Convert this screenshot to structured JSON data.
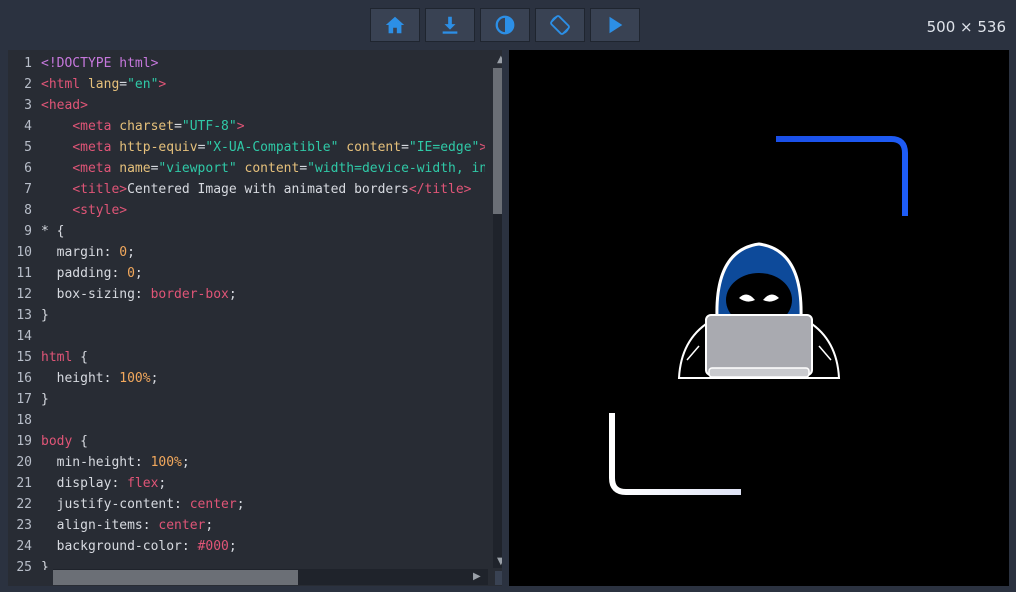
{
  "toolbar": {
    "buttons": [
      {
        "icon": "home-icon"
      },
      {
        "icon": "download-icon"
      },
      {
        "icon": "contrast-icon"
      },
      {
        "icon": "rotate-icon"
      },
      {
        "icon": "play-icon"
      }
    ],
    "accent": "#2c8fe6"
  },
  "preview_size": "500 × 536",
  "editor": {
    "line_numbers": [
      "1",
      "2",
      "3",
      "4",
      "5",
      "6",
      "7",
      "8",
      "9",
      "10",
      "11",
      "12",
      "13",
      "14",
      "15",
      "16",
      "17",
      "18",
      "19",
      "20",
      "21",
      "22",
      "23",
      "24",
      "25"
    ],
    "lines": [
      [
        [
          "doctype",
          "<!DOCTYPE html>"
        ]
      ],
      [
        [
          "tag",
          "<html "
        ],
        [
          "attr",
          "lang"
        ],
        [
          "txt",
          "="
        ],
        [
          "str",
          "\"en\""
        ],
        [
          "tag",
          ">"
        ]
      ],
      [
        [
          "tag",
          "<head>"
        ]
      ],
      [
        [
          "txt",
          "    "
        ],
        [
          "tag",
          "<meta "
        ],
        [
          "attr",
          "charset"
        ],
        [
          "txt",
          "="
        ],
        [
          "str",
          "\"UTF-8\""
        ],
        [
          "tag",
          ">"
        ]
      ],
      [
        [
          "txt",
          "    "
        ],
        [
          "tag",
          "<meta "
        ],
        [
          "attr",
          "http-equiv"
        ],
        [
          "txt",
          "="
        ],
        [
          "str",
          "\"X-UA-Compatible\""
        ],
        [
          "txt",
          " "
        ],
        [
          "attr",
          "content"
        ],
        [
          "txt",
          "="
        ],
        [
          "str",
          "\"IE=edge\""
        ],
        [
          "tag",
          ">"
        ]
      ],
      [
        [
          "txt",
          "    "
        ],
        [
          "tag",
          "<meta "
        ],
        [
          "attr",
          "name"
        ],
        [
          "txt",
          "="
        ],
        [
          "str",
          "\"viewport\""
        ],
        [
          "txt",
          " "
        ],
        [
          "attr",
          "content"
        ],
        [
          "txt",
          "="
        ],
        [
          "str",
          "\"width=device-width, ini"
        ]
      ],
      [
        [
          "txt",
          "    "
        ],
        [
          "tag",
          "<title>"
        ],
        [
          "txt",
          "Centered Image with animated borders"
        ],
        [
          "tag",
          "</title>"
        ]
      ],
      [
        [
          "txt",
          "    "
        ],
        [
          "tag",
          "<style>"
        ]
      ],
      [
        [
          "txt",
          "* {"
        ]
      ],
      [
        [
          "txt",
          "  margin: "
        ],
        [
          "num",
          "0"
        ],
        [
          "txt",
          ";"
        ]
      ],
      [
        [
          "txt",
          "  padding: "
        ],
        [
          "num",
          "0"
        ],
        [
          "txt",
          ";"
        ]
      ],
      [
        [
          "txt",
          "  box-sizing: "
        ],
        [
          "kw",
          "border-box"
        ],
        [
          "txt",
          ";"
        ]
      ],
      [
        [
          "txt",
          "}"
        ]
      ],
      [
        [
          "txt",
          ""
        ]
      ],
      [
        [
          "sel",
          "html"
        ],
        [
          "txt",
          " {"
        ]
      ],
      [
        [
          "txt",
          "  height: "
        ],
        [
          "num",
          "100%"
        ],
        [
          "txt",
          ";"
        ]
      ],
      [
        [
          "txt",
          "}"
        ]
      ],
      [
        [
          "txt",
          ""
        ]
      ],
      [
        [
          "sel",
          "body"
        ],
        [
          "txt",
          " {"
        ]
      ],
      [
        [
          "txt",
          "  min-height: "
        ],
        [
          "num",
          "100%"
        ],
        [
          "txt",
          ";"
        ]
      ],
      [
        [
          "txt",
          "  display: "
        ],
        [
          "kw",
          "flex"
        ],
        [
          "txt",
          ";"
        ]
      ],
      [
        [
          "txt",
          "  justify-content: "
        ],
        [
          "kw",
          "center"
        ],
        [
          "txt",
          ";"
        ]
      ],
      [
        [
          "txt",
          "  align-items: "
        ],
        [
          "kw",
          "center"
        ],
        [
          "txt",
          ";"
        ]
      ],
      [
        [
          "txt",
          "  background-color: "
        ],
        [
          "kw",
          "#000"
        ],
        [
          "txt",
          ";"
        ]
      ],
      [
        [
          "txt",
          "}"
        ]
      ]
    ]
  },
  "colors": {
    "bar_bg": "#2b3240",
    "editor_bg": "#282c34",
    "preview_bg": "#000000",
    "border_blue": "#1a4fe8",
    "hood_blue": "#0d4a9a"
  }
}
